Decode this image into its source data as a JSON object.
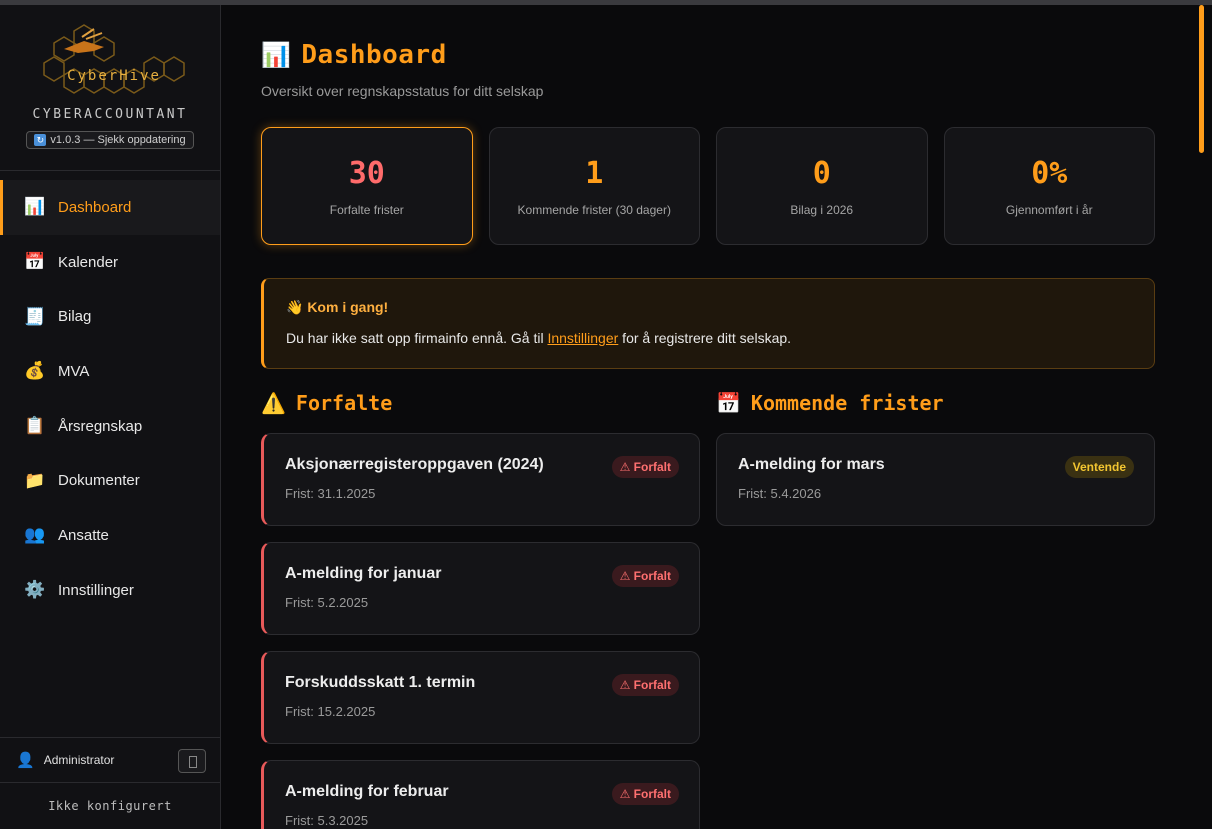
{
  "sidebar": {
    "logo_text": "CyberHive",
    "brand": "CYBERACCOUNTANT",
    "version": "v1.0.3 — Sjekk oppdatering",
    "items": [
      {
        "label": "Dashboard",
        "icon": "📊"
      },
      {
        "label": "Kalender",
        "icon": "📅"
      },
      {
        "label": "Bilag",
        "icon": "🧾"
      },
      {
        "label": "MVA",
        "icon": "💰"
      },
      {
        "label": "Årsregnskap",
        "icon": "📋"
      },
      {
        "label": "Dokumenter",
        "icon": "📁"
      },
      {
        "label": "Ansatte",
        "icon": "👥"
      },
      {
        "label": "Innstillinger",
        "icon": "⚙️"
      }
    ],
    "user": "Administrator",
    "user_icon": "👤",
    "status": "Ikke konfigurert"
  },
  "main": {
    "title_icon": "📊",
    "title": "Dashboard",
    "subtitle": "Oversikt over regnskapsstatus for ditt selskap",
    "stats": [
      {
        "value": "30",
        "label": "Forfalte frister"
      },
      {
        "value": "1",
        "label": "Kommende frister (30 dager)"
      },
      {
        "value": "0",
        "label": "Bilag i 2026"
      },
      {
        "value": "0%",
        "label": "Gjennomført i år"
      }
    ],
    "banner": {
      "title": "👋 Kom i gang!",
      "text_before": "Du har ikke satt opp firmainfo ennå. Gå til ",
      "link": "Innstillinger",
      "text_after": " for å registrere ditt selskap."
    },
    "overdue": {
      "icon": "⚠️",
      "title": "Forfalte",
      "badge": "⚠ Forfalt",
      "items": [
        {
          "title": "Aksjonærregisteroppgaven (2024)",
          "date": "Frist: 31.1.2025"
        },
        {
          "title": "A-melding for januar",
          "date": "Frist: 5.2.2025"
        },
        {
          "title": "Forskuddsskatt 1. termin",
          "date": "Frist: 15.2.2025"
        },
        {
          "title": "A-melding for februar",
          "date": "Frist: 5.3.2025"
        }
      ]
    },
    "upcoming": {
      "icon": "📅",
      "title": "Kommende frister",
      "items": [
        {
          "title": "A-melding for mars",
          "date": "Frist: 5.4.2026",
          "badge": "Ventende"
        }
      ]
    }
  },
  "colors": {
    "accent": "#ff9d1a",
    "danger": "#ff6b6b",
    "pending": "#f2c531"
  }
}
